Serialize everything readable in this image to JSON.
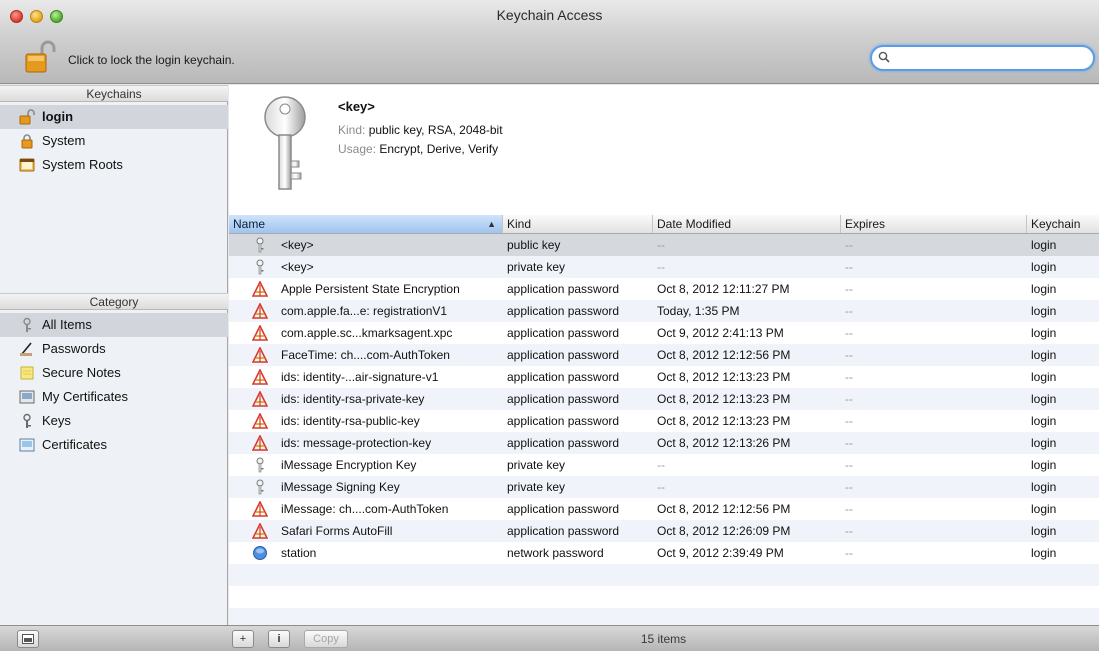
{
  "window": {
    "title": "Keychain Access",
    "traffic_lights": [
      "close",
      "minimize",
      "zoom"
    ]
  },
  "toolbar": {
    "lock_label": "Click to lock the login keychain.",
    "search_value": "",
    "search_icon": "magnifier-icon"
  },
  "sidebar": {
    "keychains_header": "Keychains",
    "keychains": [
      {
        "label": "login",
        "icon": "unlocked-keychain-icon",
        "selected": true
      },
      {
        "label": "System",
        "icon": "locked-keychain-icon",
        "selected": false
      },
      {
        "label": "System Roots",
        "icon": "system-roots-icon",
        "selected": false
      }
    ],
    "category_header": "Category",
    "categories": [
      {
        "label": "All Items",
        "icon": "all-items-icon",
        "selected": true
      },
      {
        "label": "Passwords",
        "icon": "passwords-icon",
        "selected": false
      },
      {
        "label": "Secure Notes",
        "icon": "secure-notes-icon",
        "selected": false
      },
      {
        "label": "My Certificates",
        "icon": "my-certificates-icon",
        "selected": false
      },
      {
        "label": "Keys",
        "icon": "keys-icon",
        "selected": false
      },
      {
        "label": "Certificates",
        "icon": "certificates-icon",
        "selected": false
      }
    ]
  },
  "preview": {
    "title": "<key>",
    "kind_key": "Kind:",
    "kind_value": "public key, RSA, 2048-bit",
    "usage_key": "Usage:",
    "usage_value": "Encrypt, Derive, Verify"
  },
  "table": {
    "columns": [
      "Name",
      "Kind",
      "Date Modified",
      "Expires",
      "Keychain"
    ],
    "sorted_column": "Name",
    "rows": [
      {
        "name": "<key>",
        "kind": "public key",
        "date": "--",
        "expires": "--",
        "keychain": "login",
        "icon": "key-icon"
      },
      {
        "name": "<key>",
        "kind": "private key",
        "date": "--",
        "expires": "--",
        "keychain": "login",
        "icon": "key-icon"
      },
      {
        "name": "Apple Persistent State Encryption",
        "kind": "application password",
        "date": "Oct 8, 2012 12:11:27 PM",
        "expires": "--",
        "keychain": "login",
        "icon": "app-password-icon"
      },
      {
        "name": "com.apple.fa...e: registrationV1",
        "kind": "application password",
        "date": "Today, 1:35 PM",
        "expires": "--",
        "keychain": "login",
        "icon": "app-password-icon"
      },
      {
        "name": "com.apple.sc...kmarksagent.xpc",
        "kind": "application password",
        "date": "Oct 9, 2012 2:41:13 PM",
        "expires": "--",
        "keychain": "login",
        "icon": "app-password-icon"
      },
      {
        "name": "FaceTime: ch....com-AuthToken",
        "kind": "application password",
        "date": "Oct 8, 2012 12:12:56 PM",
        "expires": "--",
        "keychain": "login",
        "icon": "app-password-icon"
      },
      {
        "name": "ids: identity-...air-signature-v1",
        "kind": "application password",
        "date": "Oct 8, 2012 12:13:23 PM",
        "expires": "--",
        "keychain": "login",
        "icon": "app-password-icon"
      },
      {
        "name": "ids: identity-rsa-private-key",
        "kind": "application password",
        "date": "Oct 8, 2012 12:13:23 PM",
        "expires": "--",
        "keychain": "login",
        "icon": "app-password-icon"
      },
      {
        "name": "ids: identity-rsa-public-key",
        "kind": "application password",
        "date": "Oct 8, 2012 12:13:23 PM",
        "expires": "--",
        "keychain": "login",
        "icon": "app-password-icon"
      },
      {
        "name": "ids: message-protection-key",
        "kind": "application password",
        "date": "Oct 8, 2012 12:13:26 PM",
        "expires": "--",
        "keychain": "login",
        "icon": "app-password-icon"
      },
      {
        "name": "iMessage Encryption Key",
        "kind": "private key",
        "date": "--",
        "expires": "--",
        "keychain": "login",
        "icon": "key-icon"
      },
      {
        "name": "iMessage Signing Key",
        "kind": "private key",
        "date": "--",
        "expires": "--",
        "keychain": "login",
        "icon": "key-icon"
      },
      {
        "name": "iMessage: ch....com-AuthToken",
        "kind": "application password",
        "date": "Oct 8, 2012 12:12:56 PM",
        "expires": "--",
        "keychain": "login",
        "icon": "app-password-icon"
      },
      {
        "name": "Safari Forms AutoFill",
        "kind": "application password",
        "date": "Oct 8, 2012 12:26:09 PM",
        "expires": "--",
        "keychain": "login",
        "icon": "app-password-icon"
      },
      {
        "name": "station",
        "kind": "network password",
        "date": "Oct 9, 2012 2:39:49 PM",
        "expires": "--",
        "keychain": "login",
        "icon": "network-password-icon"
      }
    ]
  },
  "bottombar": {
    "add_label": "+",
    "info_label": "i",
    "copy_label": "Copy",
    "item_count": "15 items"
  },
  "colors": {
    "sort_header": "#a9c9f0",
    "search_focus": "#5b9ce6",
    "selected_row": "#d5d8dd"
  }
}
